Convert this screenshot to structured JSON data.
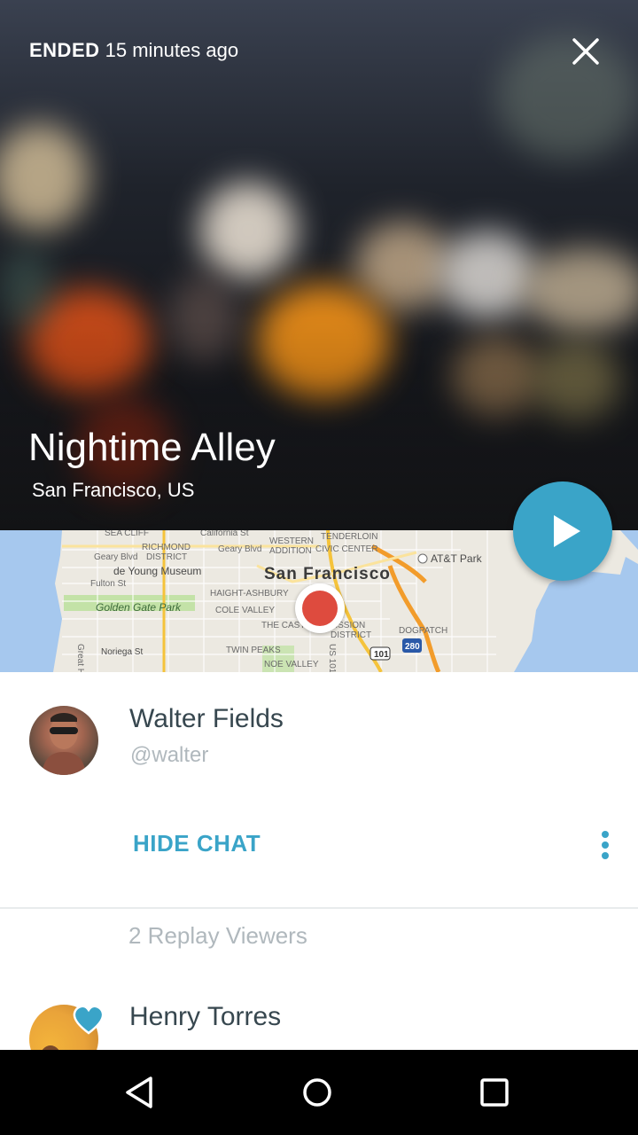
{
  "header": {
    "status_label": "ENDED",
    "status_time": "15 minutes ago"
  },
  "broadcast": {
    "title": "Nightime Alley",
    "location": "San Francisco, US"
  },
  "map": {
    "labels": {
      "sea_cliff": "SEA CLIFF",
      "california": "California St",
      "richmond": "RICHMOND",
      "district": "DISTRICT",
      "geary1": "Geary Blvd",
      "geary2": "Geary Blvd",
      "western": "WESTERN",
      "addition": "ADDITION",
      "tenderloin": "TENDERLOIN",
      "civic": "CIVIC CENTER",
      "young": "de Young Museum",
      "sf": "San Francisco",
      "att": "AT&T Park",
      "fulton": "Fulton St",
      "haight": "HAIGHT-ASHBURY",
      "ggpark": "Golden Gate Park",
      "cole": "COLE VALLEY",
      "castro": "THE CASTRO",
      "mission": "MISSION",
      "mission_district": "DISTRICT",
      "dogpatch": "DOGPATCH",
      "noriega": "Noriega St",
      "twin": "TWIN PEAKS",
      "noe": "NOE VALLEY",
      "great": "Great H",
      "us101": "US 101",
      "hw101": "101",
      "hw280": "280"
    }
  },
  "broadcaster": {
    "name": "Walter Fields",
    "handle": "@walter"
  },
  "actions": {
    "hide_chat": "HIDE CHAT"
  },
  "viewers": {
    "summary": "2 Replay Viewers",
    "list": [
      {
        "name": "Henry Torres"
      }
    ]
  },
  "colors": {
    "accent": "#3aa4c8",
    "pin": "#de4b3e",
    "text_dark": "#37474f",
    "text_muted": "#b0b8bd"
  },
  "icons": {
    "close": "close-icon",
    "play": "play-icon",
    "more": "more-vertical-icon",
    "heart": "heart-icon",
    "back": "back-icon",
    "home": "home-icon",
    "recents": "recents-icon"
  }
}
